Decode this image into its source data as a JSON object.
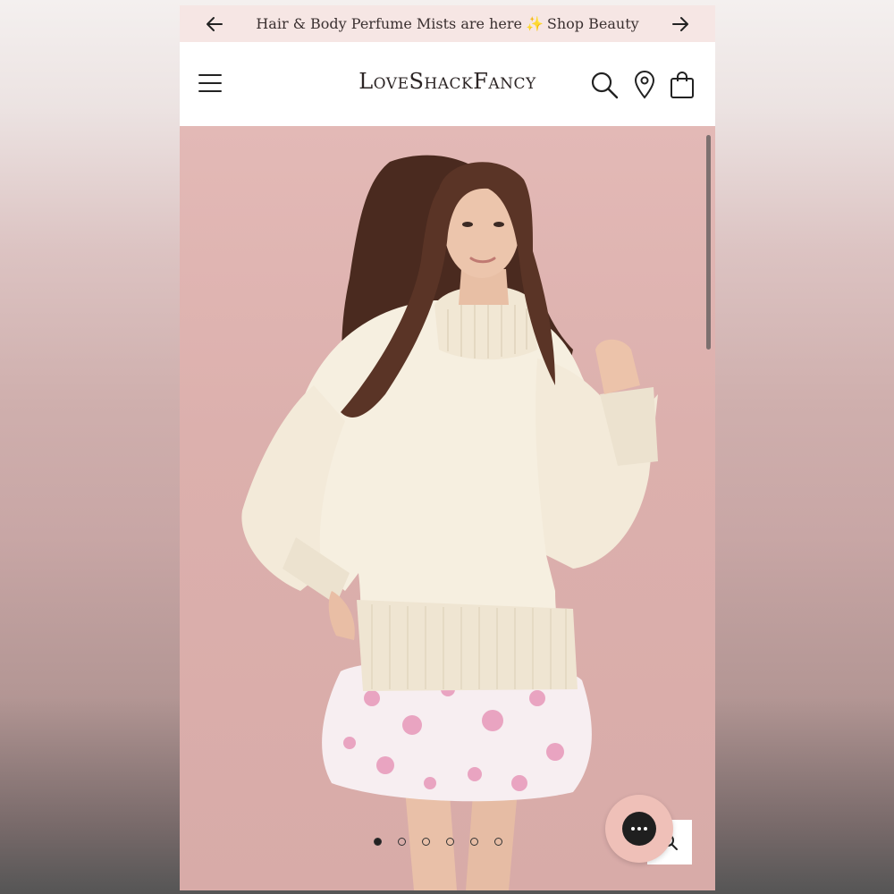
{
  "promo": {
    "text_before": "Hair & Body Perfume Mists are here",
    "sparkle": "✨",
    "link_text": "Shop Beauty"
  },
  "header": {
    "logo": "LoveShackFancy"
  },
  "hero": {
    "image_description_icon": "product-photo",
    "carousel_total": 6,
    "carousel_active": 1
  },
  "colors": {
    "promo_bg": "#f6e6e4",
    "hero_bg": "#dcb0ad",
    "chat_bg": "#efc0b8"
  }
}
